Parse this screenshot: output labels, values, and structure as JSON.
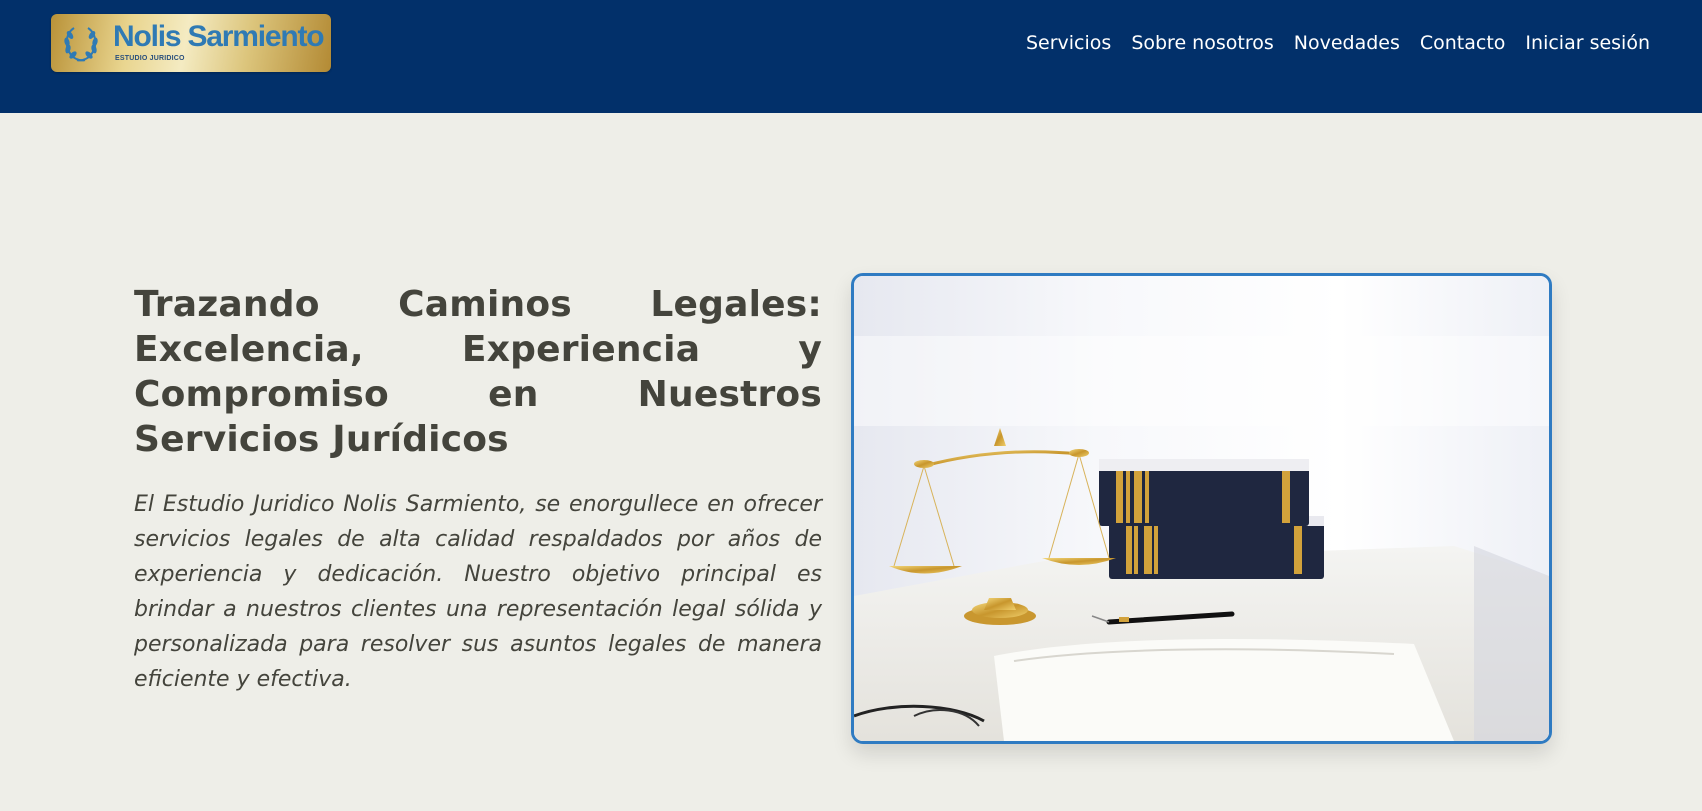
{
  "brand": {
    "name": "Nolis Sarmiento",
    "subtitle": "ESTUDIO JURIDICO",
    "logo_icon": "laurel-wreath-icon",
    "colors": {
      "header_bg": "#02306a",
      "logo_gold": "#e9d58f",
      "logo_text": "#2f7ab4",
      "accent_border": "#2f7bc2",
      "page_bg": "#eeeee8",
      "text": "#44443c"
    }
  },
  "nav": {
    "items": [
      {
        "label": "Servicios"
      },
      {
        "label": "Sobre nosotros"
      },
      {
        "label": "Novedades"
      },
      {
        "label": "Contacto"
      },
      {
        "label": "Iniciar sesión"
      }
    ]
  },
  "hero": {
    "title": "Trazando Caminos Legales: Excelencia, Experiencia y Compromiso en Nuestros Servicios Jurídicos",
    "description": "El Estudio Juridico Nolis Sarmiento, se enorgullece en ofrecer servicios legales de alta calidad respaldados por años de experiencia y dedicación. Nuestro objetivo principal es brindar a nuestros clientes una representación legal sólida y personalizada para resolver sus asuntos legales de manera eficiente y efectiva.",
    "image": "scales-of-justice-books-pen-photo"
  }
}
